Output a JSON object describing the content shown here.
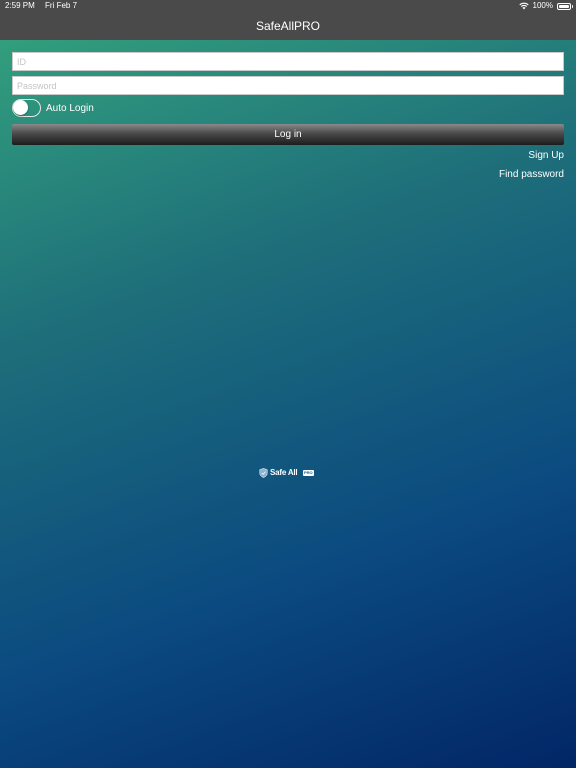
{
  "status_bar": {
    "time": "2:59 PM",
    "date": "Fri Feb 7",
    "battery": "100%",
    "icons": [
      "wifi-icon",
      "battery-icon"
    ]
  },
  "nav": {
    "title": "SafeAllPRO"
  },
  "login_form": {
    "id_placeholder": "ID",
    "password_placeholder": "Password",
    "auto_login_label": "Auto Login",
    "auto_login_enabled": false,
    "login_button_label": "Log in",
    "sign_up_label": "Sign Up",
    "find_password_label": "Find password"
  },
  "logo": {
    "text": "Safe All",
    "badge": "PRO",
    "icon": "shield-icon"
  },
  "colors": {
    "bar_background": "#4a4a4a",
    "gradient_top": "#35a57d",
    "gradient_bottom": "#022667",
    "text": "#ffffff"
  }
}
